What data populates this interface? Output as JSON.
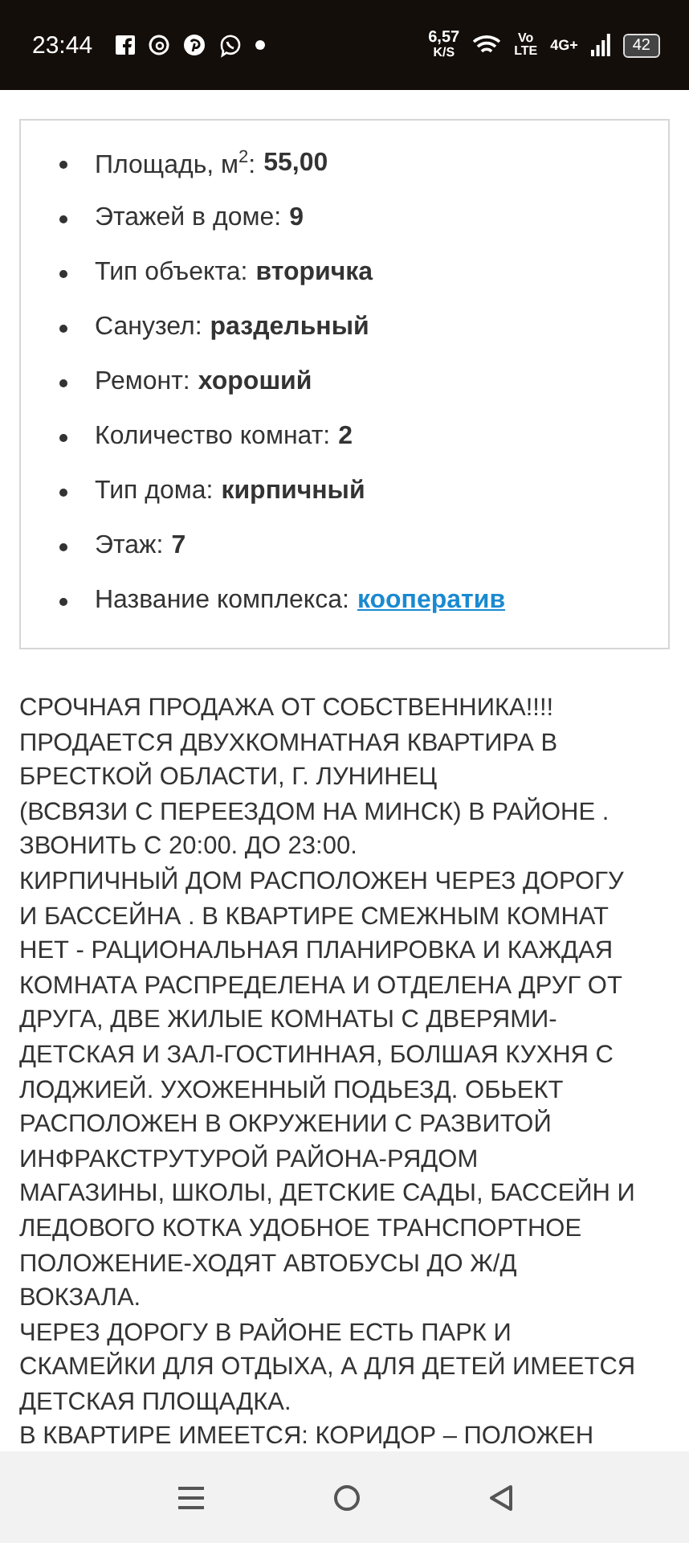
{
  "status_bar": {
    "time": "23:44",
    "speed": "6,57",
    "speed_unit": "K/S",
    "volte_top": "Vo",
    "volte_bottom": "LTE",
    "network": "4G+",
    "battery": "42"
  },
  "details": [
    {
      "label": "Площадь, м$^{2}$:",
      "value": "55,00",
      "kind": "text"
    },
    {
      "label": "Этажей в доме:",
      "value": "9",
      "kind": "text"
    },
    {
      "label": "Тип объекта:",
      "value": "вторичка",
      "kind": "text"
    },
    {
      "label": "Санузел:",
      "value": "раздельный",
      "kind": "text"
    },
    {
      "label": "Ремонт:",
      "value": "хороший",
      "kind": "text"
    },
    {
      "label": "Количество комнат:",
      "value": "2",
      "kind": "text"
    },
    {
      "label": "Тип дома:",
      "value": "кирпичный",
      "kind": "text"
    },
    {
      "label": "Этаж:",
      "value": "7",
      "kind": "text"
    },
    {
      "label": "Название комплекса:",
      "value": "кооператив",
      "kind": "link"
    }
  ],
  "description": [
    "СРОЧНАЯ ПРОДАЖА ОТ СОБСТВЕННИКА!!!!",
    "ПРОДАЕТСЯ ДВУХКОМНАТНАЯ КВАРТИРА В",
    "БРЕСТКОЙ ОБЛАСТИ, Г. ЛУНИНЕЦ",
    "(ВСВЯЗИ С ПЕРЕЕЗДОМ НА МИНСК) В РАЙОНЕ .",
    "ЗВОНИТЬ С 20:00. ДО 23:00.",
    "КИРПИЧНЫЙ ДОМ РАСПОЛОЖЕН ЧЕРЕЗ ДОРОГУ",
    "И БАССЕЙНА . В КВАРТИРЕ СМЕЖНЫМ КОМНАТ",
    "НЕТ - РАЦИОНАЛЬНАЯ ПЛАНИРОВКА И КАЖДАЯ",
    "КОМНАТА РАСПРЕДЕЛЕНА И ОТДЕЛЕНА ДРУГ ОТ",
    "ДРУГА, ДВЕ ЖИЛЫЕ КОМНАТЫ С ДВЕРЯМИ-",
    "ДЕТСКАЯ И ЗАЛ-ГОСТИННАЯ, БОЛШАЯ КУХНЯ С",
    "ЛОДЖИЕЙ. УХОЖЕННЫЙ ПОДЬЕЗД. ОБЬЕКТ",
    "РАСПОЛОЖЕН В ОКРУЖЕНИИ С РАЗВИТОЙ",
    "ИНФРАКСТРУТУРОЙ РАЙОНА-РЯДОМ",
    "МАГАЗИНЫ, ШКОЛЫ, ДЕТСКИЕ САДЫ, БАССЕЙН И",
    "ЛЕДОВОГО КОТКА УДОБНОЕ ТРАНСПОРТНОЕ",
    "ПОЛОЖЕНИЕ-ХОДЯТ АВТОБУСЫ ДО Ж/Д",
    "ВОКЗАЛА.",
    "ЧЕРЕЗ ДОРОГУ В РАЙОНЕ ЕСТЬ ПАРК И",
    "СКАМЕЙКИ ДЛЯ ОТДЫХА, А ДЛЯ ДЕТЕЙ ИМЕЕТСЯ",
    "ДЕТСКАЯ ПЛОЩАДКА.",
    "В КВАРТИРЕ ИМЕЕТСЯ: КОРИДОР – ПОЛОЖЕН"
  ]
}
